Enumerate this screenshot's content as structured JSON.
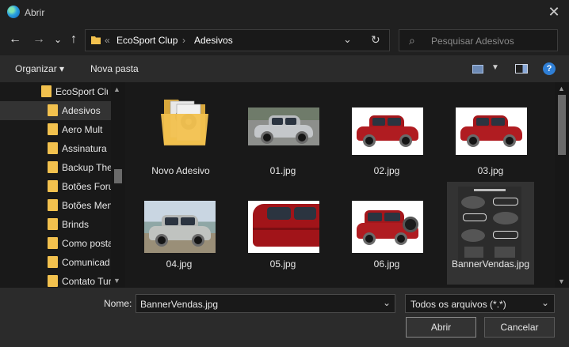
{
  "window": {
    "title": "Abrir",
    "close_label": "✕"
  },
  "nav": {
    "back_label": "←",
    "forward_label": "→",
    "recent_label": "⌄",
    "up_label": "↑",
    "address": {
      "overflow_label": "«",
      "crumbs": [
        "EcoSport Clup",
        "Adesivos"
      ],
      "separator": "›",
      "dropdown_label": "⌄",
      "refresh_label": "↻"
    },
    "search": {
      "placeholder": "Pesquisar Adesivos",
      "icon_label": "⌕"
    }
  },
  "toolbar": {
    "organize_label": "Organizar ▾",
    "new_folder_label": "Nova pasta",
    "view_dropdown_label": "▼",
    "help_label": "?"
  },
  "sidebar": {
    "parent_label": "EcoSport Clup",
    "items": [
      "Adesivos",
      "Aero Mult",
      "Assinatura",
      "Backup The",
      "Botões Foru",
      "Botões Men",
      "Brinds",
      "Como posta",
      "Comunicad",
      "Contato Tur"
    ],
    "scroll_up_label": "▲",
    "scroll_down_label": "▼"
  },
  "files": [
    {
      "name": "Novo Adesivo",
      "type": "folder"
    },
    {
      "name": "01.jpg",
      "type": "image",
      "icon": "silver-car-thumbnail"
    },
    {
      "name": "02.jpg",
      "type": "image",
      "icon": "red-car-thumbnail"
    },
    {
      "name": "03.jpg",
      "type": "image",
      "icon": "red-car-thumbnail"
    },
    {
      "name": "04.jpg",
      "type": "image",
      "icon": "silver-car-beach-thumbnail"
    },
    {
      "name": "05.jpg",
      "type": "image",
      "icon": "red-car-closeup-thumbnail"
    },
    {
      "name": "06.jpg",
      "type": "image",
      "icon": "red-car-rear-thumbnail"
    },
    {
      "name": "BannerVendas.jpg",
      "type": "image",
      "icon": "banner-thumbnail",
      "selected": true
    }
  ],
  "content_scroll": {
    "up_label": "▲",
    "down_label": "▼"
  },
  "footer": {
    "name_label": "Nome:",
    "name_value": "BannerVendas.jpg",
    "name_dropdown_label": "⌄",
    "file_type_value": "Todos os arquivos (*.*)",
    "file_type_dropdown_label": "⌄",
    "open_label": "Abrir",
    "cancel_label": "Cancelar"
  },
  "colors": {
    "background": "#202020",
    "pane": "#191919",
    "selection": "#333333",
    "folder": "#f2c14e",
    "car_red": "#a5161b",
    "car_silver": "#b9bcbf",
    "help_blue": "#2f7fd6"
  }
}
